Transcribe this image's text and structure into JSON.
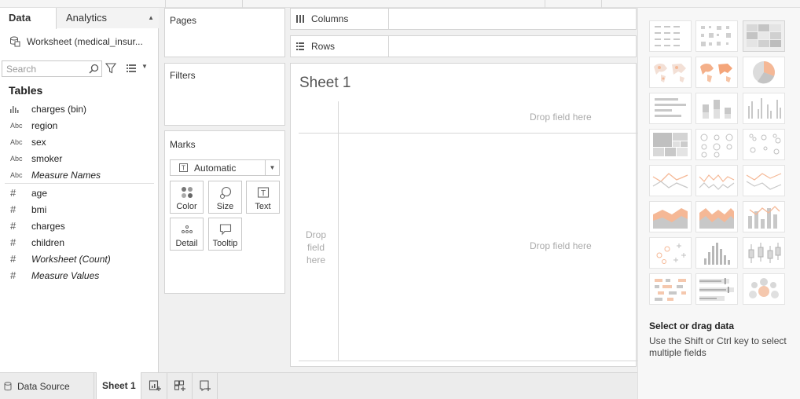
{
  "data_tabs": {
    "data_label": "Data",
    "analytics_label": "Analytics"
  },
  "datasource": {
    "label": "Worksheet (medical_insur..."
  },
  "search": {
    "placeholder": "Search"
  },
  "tables": {
    "title": "Tables",
    "dimensions": [
      {
        "icon": "bin-icon",
        "type": "bin",
        "label": "charges (bin)",
        "italic": false
      },
      {
        "icon": "abc-icon",
        "type": "Abc",
        "label": "region",
        "italic": false
      },
      {
        "icon": "abc-icon",
        "type": "Abc",
        "label": "sex",
        "italic": false
      },
      {
        "icon": "abc-icon",
        "type": "Abc",
        "label": "smoker",
        "italic": false
      },
      {
        "icon": "abc-icon",
        "type": "Abc",
        "label": "Measure Names",
        "italic": true
      }
    ],
    "measures": [
      {
        "icon": "hash-icon",
        "type": "#",
        "label": "age",
        "italic": false
      },
      {
        "icon": "hash-icon",
        "type": "#",
        "label": "bmi",
        "italic": false
      },
      {
        "icon": "hash-icon",
        "type": "#",
        "label": "charges",
        "italic": false
      },
      {
        "icon": "hash-icon",
        "type": "#",
        "label": "children",
        "italic": false
      },
      {
        "icon": "hash-icon",
        "type": "#",
        "label": "Worksheet (Count)",
        "italic": true
      },
      {
        "icon": "hash-icon",
        "type": "#",
        "label": "Measure Values",
        "italic": true
      }
    ]
  },
  "cards": {
    "pages": "Pages",
    "filters": "Filters",
    "marks": "Marks"
  },
  "marks": {
    "type_label": "Automatic",
    "buttons": {
      "color": "Color",
      "size": "Size",
      "text": "Text",
      "detail": "Detail",
      "tooltip": "Tooltip"
    }
  },
  "shelves": {
    "columns": "Columns",
    "rows": "Rows"
  },
  "sheet": {
    "title": "Sheet 1",
    "drop_cols": "Drop field here",
    "drop_rows_1": "Drop",
    "drop_rows_2": "field",
    "drop_rows_3": "here",
    "drop_center": "Drop field here"
  },
  "showme": {
    "title": "Select or drag data",
    "description": "Use the Shift or Ctrl key to select multiple fields",
    "thumbnails": [
      "text-table",
      "heat-map",
      "highlight-table",
      "symbol-map",
      "filled-map",
      "pie-chart",
      "horizontal-bars",
      "stacked-bars",
      "side-by-side-bars",
      "treemap",
      "circle-view",
      "side-by-side-circles",
      "lines-continuous",
      "lines-discrete",
      "dual-lines",
      "area-continuous",
      "area-discrete",
      "dual-combination",
      "scatter-plot",
      "histogram",
      "box-and-whisker",
      "gantt-chart",
      "bullet-graph",
      "packed-bubbles"
    ]
  },
  "bottom_tabs": {
    "datasource": "Data Source",
    "sheet": "Sheet 1"
  },
  "colors": {
    "accent_orange": "#f5a97f",
    "grey_thumb": "#bdbdbd",
    "blue_tab": "#1f77b4"
  }
}
